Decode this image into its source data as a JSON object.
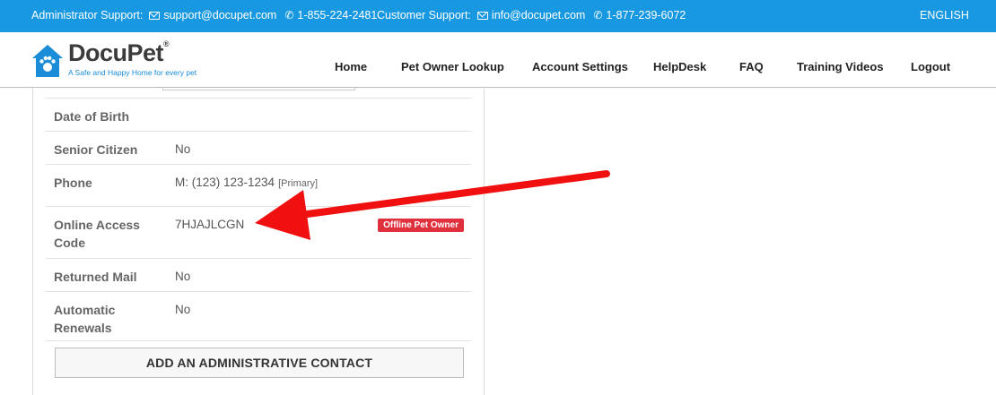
{
  "topbar": {
    "admin_label": "Administrator Support:",
    "admin_email": "support@docupet.com",
    "admin_phone": "1-855-224-2481",
    "customer_label": "Customer Support:",
    "customer_email": "info@docupet.com",
    "customer_phone": "1-877-239-6072",
    "language": "ENGLISH"
  },
  "logo": {
    "name": "DocuPet",
    "reg": "®",
    "tagline": "A Safe and Happy Home for every pet"
  },
  "nav": {
    "items": [
      "Home",
      "Pet Owner Lookup",
      "Account Settings",
      "HelpDesk",
      "FAQ",
      "Training Videos",
      "Logout"
    ]
  },
  "fields": {
    "dob": {
      "label": "Date of Birth",
      "value": ""
    },
    "senior": {
      "label": "Senior Citizen",
      "value": "No"
    },
    "phone": {
      "label": "Phone",
      "value": "M: (123) 123-1234",
      "tag": "[Primary]"
    },
    "access": {
      "label": "Online Access Code",
      "value": "7HJAJLCGN",
      "badge": "Offline Pet Owner"
    },
    "mail": {
      "label": "Returned Mail",
      "value": "No"
    },
    "renewals": {
      "label": "Automatic Renewals",
      "value": "No"
    }
  },
  "actions": {
    "add_contact": "ADD AN ADMINISTRATIVE CONTACT"
  },
  "colors": {
    "topbar": "#1798e0",
    "brand_blue": "#1a8cd8",
    "badge_red": "#e0303d",
    "arrow_red": "#f01010"
  }
}
